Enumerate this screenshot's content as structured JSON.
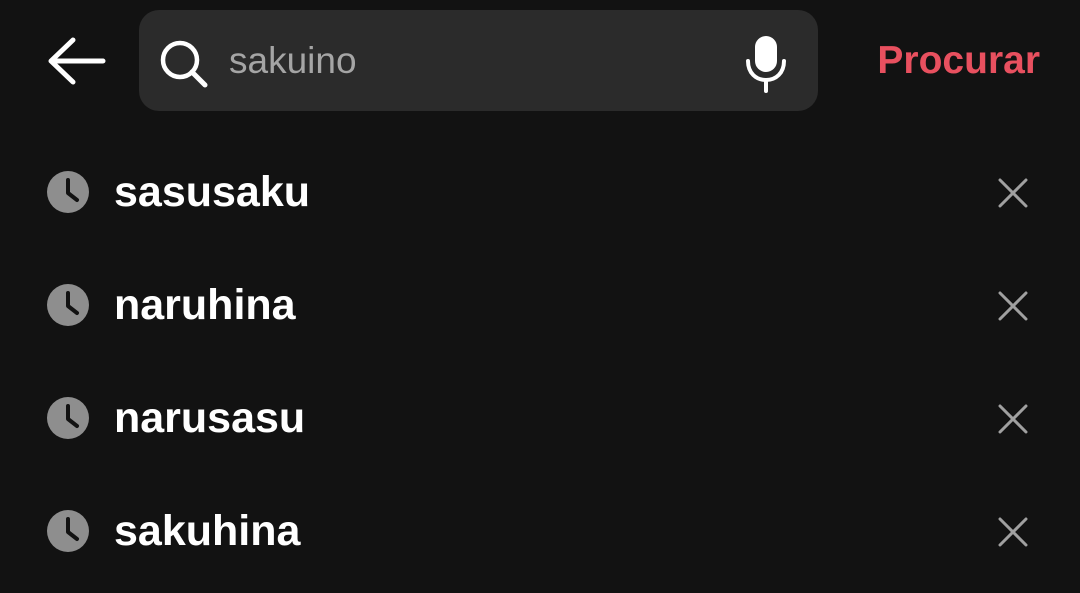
{
  "header": {
    "back_icon": "arrow-left-icon",
    "search": {
      "value": "sakuino",
      "search_icon": "magnifier-icon",
      "mic_icon": "microphone-icon"
    },
    "submit_label": "Procurar",
    "accent_color": "#e8505f"
  },
  "history": {
    "item_icon": "clock-icon",
    "remove_icon": "close-icon",
    "items": [
      {
        "label": "sasusaku"
      },
      {
        "label": "naruhina"
      },
      {
        "label": "narusasu"
      },
      {
        "label": "sakuhina"
      }
    ]
  }
}
